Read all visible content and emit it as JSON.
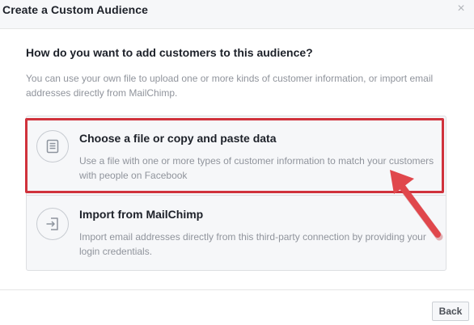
{
  "dialog": {
    "title": "Create a Custom Audience",
    "close_icon": "close-icon"
  },
  "prompt": {
    "question": "How do you want to add customers to this audience?",
    "description": "You can use your own file to upload one or more kinds of customer information, or import email addresses directly from MailChimp."
  },
  "options": [
    {
      "icon": "document-list-icon",
      "title": "Choose a file or copy and paste data",
      "description": "Use a file with one or more types of customer information to match your customers with people on Facebook",
      "highlighted": true
    },
    {
      "icon": "import-arrow-icon",
      "title": "Import from MailChimp",
      "description": "Import email addresses directly from this third-party connection by providing your login credentials."
    }
  ],
  "footer": {
    "back_label": "Back"
  },
  "colors": {
    "highlight": "#d0323c",
    "arrow": "#e0474c"
  }
}
